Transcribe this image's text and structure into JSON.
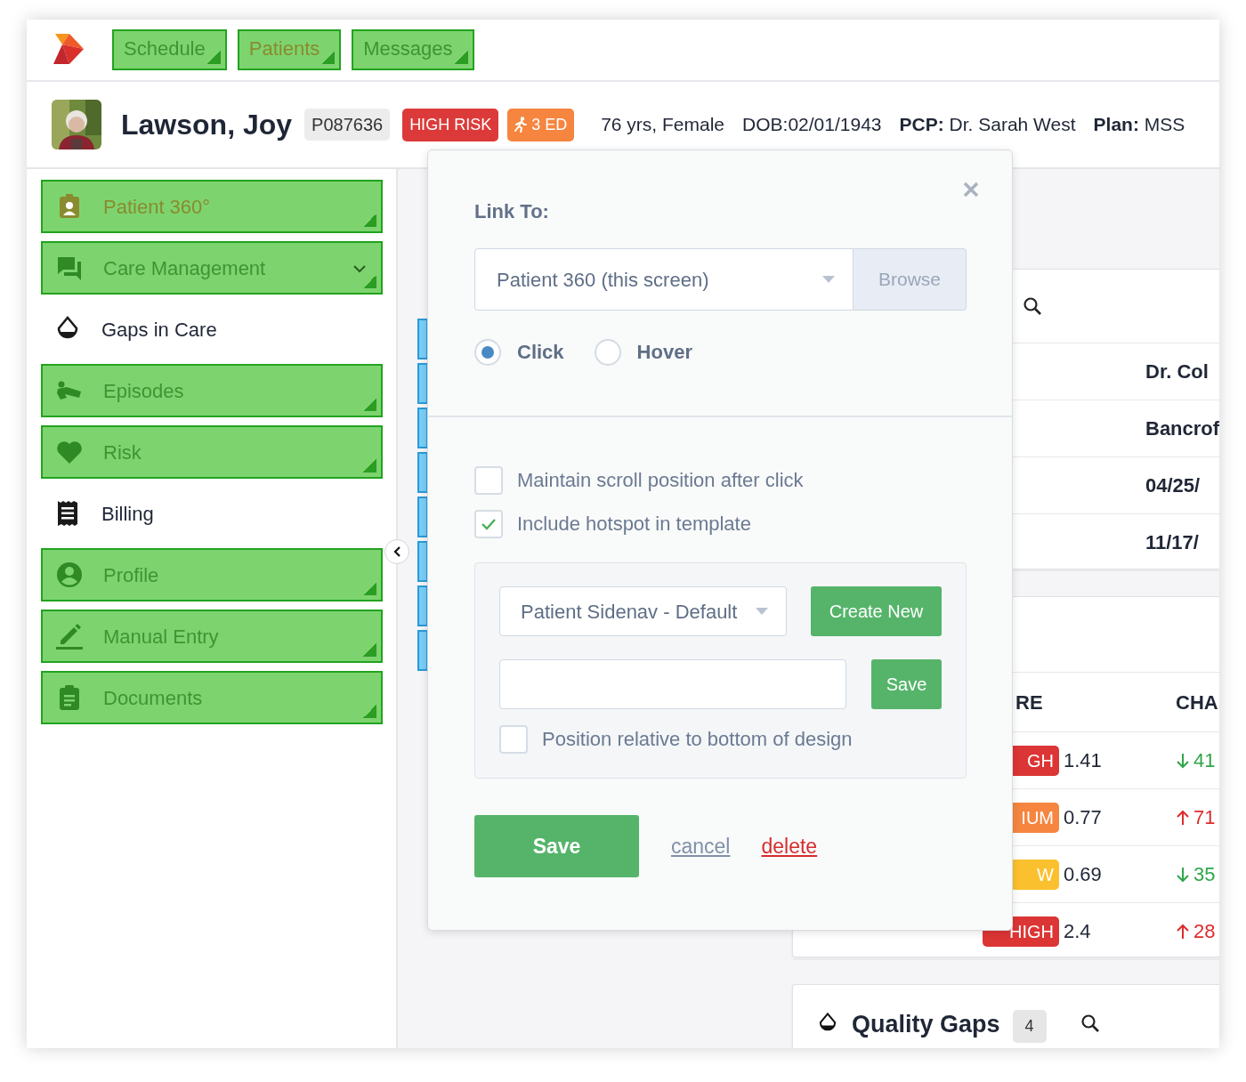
{
  "top_nav": {
    "items": [
      {
        "label": "Schedule",
        "selected": false
      },
      {
        "label": "Patients",
        "selected": true
      },
      {
        "label": "Messages",
        "selected": false
      }
    ]
  },
  "patient": {
    "name": "Lawson, Joy",
    "id": "P087636",
    "flags": [
      {
        "text": "HIGH RISK",
        "kind": "risk"
      },
      {
        "text": "3 ED",
        "kind": "ed"
      }
    ],
    "facts": [
      "76 yrs, Female",
      "DOB:02/01/1943",
      "**PCP:** Dr. Sarah West",
      "**Plan:** MSS"
    ]
  },
  "sidebar": {
    "items": [
      {
        "label": "Patient 360°",
        "kind": "hotspot",
        "selected": true,
        "submenu": false
      },
      {
        "label": "Care Management",
        "kind": "hotspot",
        "selected": false,
        "submenu": true
      },
      {
        "label": "Gaps in Care",
        "kind": "plain",
        "selected": false,
        "submenu": false
      },
      {
        "label": "Episodes",
        "kind": "hotspot",
        "selected": false,
        "submenu": false
      },
      {
        "label": "Risk",
        "kind": "hotspot",
        "selected": false,
        "submenu": false
      },
      {
        "label": "Billing",
        "kind": "plain",
        "selected": false,
        "submenu": false
      },
      {
        "label": "Profile",
        "kind": "hotspot",
        "selected": false,
        "submenu": false
      },
      {
        "label": "Manual Entry",
        "kind": "hotspot",
        "selected": false,
        "submenu": false
      },
      {
        "label": "Documents",
        "kind": "hotspot",
        "selected": false,
        "submenu": false
      }
    ]
  },
  "providers_card": {
    "rows": [
      "Dr. Col",
      "Bancrof",
      "04/25/",
      "11/17/"
    ]
  },
  "scores_card": {
    "columns": [
      "RE",
      "CHA"
    ],
    "rows": [
      {
        "color": "#dc3535",
        "badge": "GH",
        "value": "1.41",
        "rising": false,
        "change": "41"
      },
      {
        "color": "#f5853f",
        "badge": "IUM",
        "value": "0.77",
        "rising": true,
        "change": "71"
      },
      {
        "color": "#fbc02d",
        "badge": "W",
        "value": "0.69",
        "rising": false,
        "change": "35"
      },
      {
        "color": "#dc3535",
        "badge": "HIGH",
        "value": "2.4",
        "rising": true,
        "change": "28"
      }
    ]
  },
  "quality_gaps": {
    "title": "Quality Gaps",
    "count": "4"
  },
  "popover": {
    "title": "Link To:",
    "link_select": "Patient 360 (this screen)",
    "browse": "Browse",
    "trigger_options": [
      {
        "label": "Click",
        "selected": true
      },
      {
        "label": "Hover",
        "selected": false
      }
    ],
    "options": [
      {
        "label": "Maintain scroll position after click",
        "checked": false
      },
      {
        "label": "Include hotspot in template",
        "checked": true
      }
    ],
    "template": {
      "select": "Patient Sidenav - Default",
      "create": "Create New",
      "save": "Save",
      "option": {
        "label": "Position relative to bottom of design",
        "checked": false
      }
    },
    "save": "Save",
    "cancel": "cancel",
    "delete": "delete"
  }
}
